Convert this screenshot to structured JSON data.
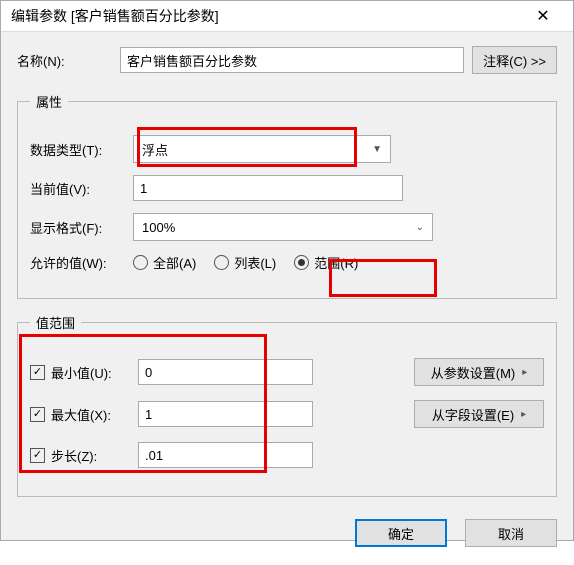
{
  "title": "编辑参数 [客户销售额百分比参数]",
  "name_row": {
    "label": "名称(N):",
    "value": "客户销售额百分比参数",
    "comment_btn": "注释(C) >>"
  },
  "attributes": {
    "legend": "属性",
    "datatype": {
      "label": "数据类型(T):",
      "value": "浮点"
    },
    "current": {
      "label": "当前值(V):",
      "value": "1"
    },
    "format": {
      "label": "显示格式(F):",
      "value": "100%"
    },
    "allowable": {
      "label": "允许的值(W):",
      "all": "全部(A)",
      "list": "列表(L)",
      "range": "范围(R)",
      "selected": "range"
    }
  },
  "range": {
    "legend": "值范围",
    "min": {
      "label": "最小值(U):",
      "checked": true,
      "value": "0",
      "btn": "从参数设置(M)"
    },
    "max": {
      "label": "最大值(X):",
      "checked": true,
      "value": "1",
      "btn": "从字段设置(E)"
    },
    "step": {
      "label": "步长(Z):",
      "checked": true,
      "value": ".01"
    }
  },
  "buttons": {
    "ok": "确定",
    "cancel": "取消"
  }
}
